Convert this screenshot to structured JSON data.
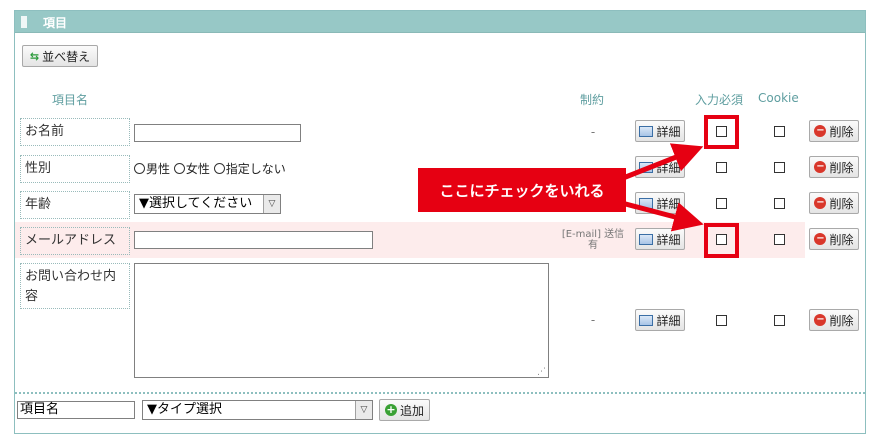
{
  "panel": {
    "title": "項目"
  },
  "sort_button": {
    "label": "並べ替え",
    "icon": "sort-arrows-icon"
  },
  "columns": {
    "item_name": "項目名",
    "constraint": "制約",
    "required": "入力必須",
    "cookie": "Cookie"
  },
  "rows": [
    {
      "label": "お名前",
      "constraint": "-"
    },
    {
      "label": "性別",
      "constraint": "",
      "options": [
        "男性",
        "女性",
        "指定しない"
      ]
    },
    {
      "label": "年齢",
      "constraint": "",
      "select": "▼選択してください"
    },
    {
      "label": "メールアドレス",
      "constraint": "[E-mail] 送信有"
    },
    {
      "label": "お問い合わせ内容",
      "constraint": "-"
    }
  ],
  "detail_label": "詳細",
  "delete_label": "削除",
  "callout": {
    "text": "ここにチェックをいれる",
    "color": "#e60012"
  },
  "footer": {
    "name_value": "項目名",
    "type_select": "▼タイプ選択",
    "add_label": "追加"
  }
}
